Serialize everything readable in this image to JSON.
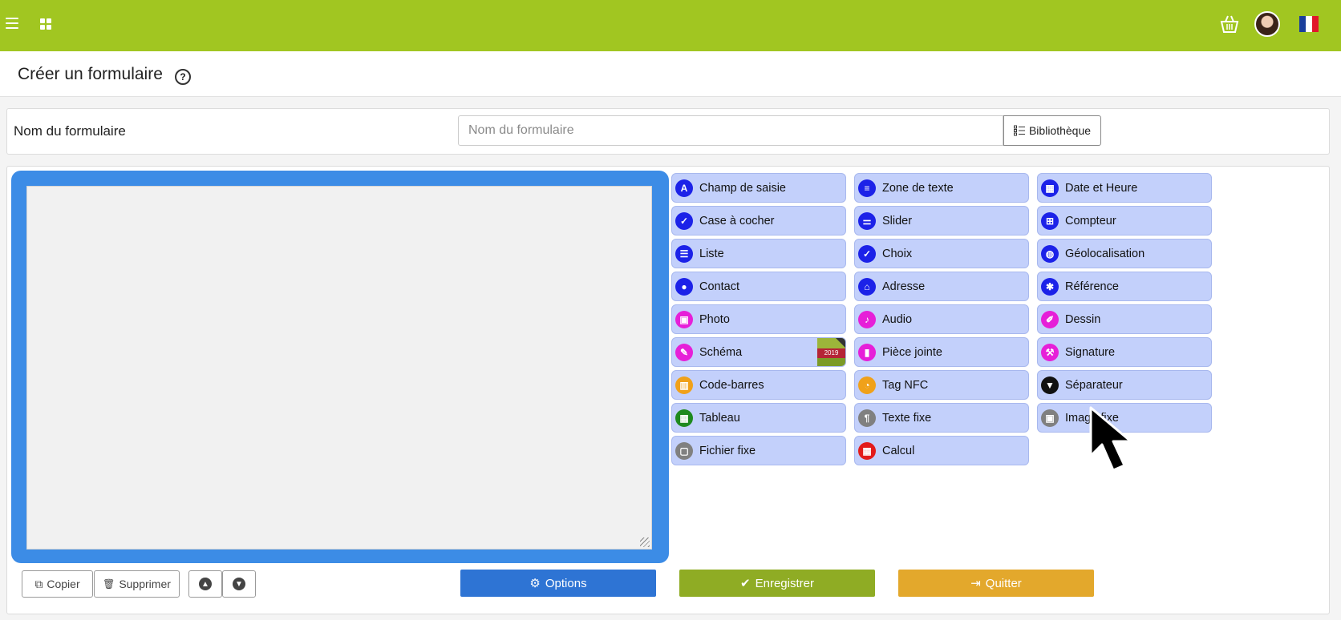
{
  "header": {
    "menu_icon": "hamburger-icon",
    "apps_icon": "grid-icon",
    "basket_icon": "basket-icon",
    "avatar_icon": "user-avatar",
    "flag_icon": "french-flag-icon",
    "flag_colors": [
      "#1a3e9b",
      "#ffffff",
      "#e1162b"
    ],
    "bar_color": "#a1c621"
  },
  "page": {
    "title": "Créer un formulaire",
    "help_icon": "question-circle-icon",
    "help_glyph": "?"
  },
  "form_name": {
    "label": "Nom du formulaire",
    "placeholder": "Nom du formulaire",
    "value": "",
    "library_button": "Bibliothèque",
    "library_icon": "list-icon"
  },
  "palette": {
    "columns": [
      [
        {
          "label": "Champ de saisie",
          "icon": "letter-a-icon",
          "glyph": "A",
          "color": "#1c22e8"
        },
        {
          "label": "Case à cocher",
          "icon": "checkbox-icon",
          "glyph": "✓",
          "color": "#1c22e8"
        },
        {
          "label": "Liste",
          "icon": "list-icon",
          "glyph": "☰",
          "color": "#1c22e8"
        },
        {
          "label": "Contact",
          "icon": "user-icon",
          "glyph": "●",
          "color": "#1c22e8"
        },
        {
          "label": "Photo",
          "icon": "image-icon",
          "glyph": "▣",
          "color": "#e61fd8"
        },
        {
          "label": "Schéma",
          "icon": "pencil-icon",
          "glyph": "✎",
          "color": "#e61fd8",
          "badge": "2019"
        },
        {
          "label": "Code-barres",
          "icon": "barcode-icon",
          "glyph": "▥",
          "color": "#f0a11a"
        },
        {
          "label": "Tableau",
          "icon": "table-icon",
          "glyph": "▦",
          "color": "#1f8a1f"
        },
        {
          "label": "Fichier fixe",
          "icon": "file-icon",
          "glyph": "▢",
          "color": "#808080"
        }
      ],
      [
        {
          "label": "Zone de texte",
          "icon": "align-left-icon",
          "glyph": "≡",
          "color": "#1c22e8"
        },
        {
          "label": "Slider",
          "icon": "sliders-icon",
          "glyph": "⚌",
          "color": "#1c22e8"
        },
        {
          "label": "Choix",
          "icon": "check-circle-icon",
          "glyph": "✓",
          "color": "#1c22e8"
        },
        {
          "label": "Adresse",
          "icon": "home-icon",
          "glyph": "⌂",
          "color": "#1c22e8"
        },
        {
          "label": "Audio",
          "icon": "microphone-icon",
          "glyph": "♪",
          "color": "#e61fd8"
        },
        {
          "label": "Pièce jointe",
          "icon": "attachment-icon",
          "glyph": "▮",
          "color": "#e61fd8"
        },
        {
          "label": "Tag NFC",
          "icon": "rss-icon",
          "glyph": "◔",
          "color": "#f0a11a"
        },
        {
          "label": "Texte fixe",
          "icon": "paragraph-icon",
          "glyph": "¶",
          "color": "#808080"
        },
        {
          "label": "Calcul",
          "icon": "calculator-icon",
          "glyph": "▦",
          "color": "#e31b1b"
        }
      ],
      [
        {
          "label": "Date et Heure",
          "icon": "calendar-icon",
          "glyph": "▦",
          "color": "#1c22e8"
        },
        {
          "label": "Compteur",
          "icon": "plus-square-icon",
          "glyph": "⊞",
          "color": "#1c22e8"
        },
        {
          "label": "Géolocalisation",
          "icon": "globe-icon",
          "glyph": "◍",
          "color": "#1c22e8"
        },
        {
          "label": "Référence",
          "icon": "asterisk-icon",
          "glyph": "✱",
          "color": "#1c22e8"
        },
        {
          "label": "Dessin",
          "icon": "brush-icon",
          "glyph": "✐",
          "color": "#e61fd8"
        },
        {
          "label": "Signature",
          "icon": "gavel-icon",
          "glyph": "⚒",
          "color": "#e61fd8"
        },
        {
          "label": "Séparateur",
          "icon": "bookmark-icon",
          "glyph": "▼",
          "color": "#111111"
        },
        {
          "label": "Image fixe",
          "icon": "image-file-icon",
          "glyph": "▣",
          "color": "#808080"
        }
      ]
    ],
    "button_color": "#c3d0fb"
  },
  "canvas": {
    "frame_color": "#3c8ce6"
  },
  "toolbar": {
    "copy": {
      "label": "Copier",
      "icon": "copy-icon",
      "glyph": "⧉"
    },
    "delete": {
      "label": "Supprimer",
      "icon": "trash-icon",
      "glyph": "🗑"
    },
    "move_up_icon": "chevron-up-circle-icon",
    "move_up_glyph": "▲",
    "move_down_icon": "chevron-down-circle-icon",
    "move_down_glyph": "▼"
  },
  "actions": {
    "options": {
      "label": "Options",
      "icon": "gear-icon",
      "glyph": "⚙",
      "color": "#2e74d4"
    },
    "save": {
      "label": "Enregistrer",
      "icon": "check-icon",
      "glyph": "✔",
      "color": "#8fac24"
    },
    "quit": {
      "label": "Quitter",
      "icon": "sign-out-icon",
      "glyph": "⇥",
      "color": "#e3a82c"
    }
  }
}
